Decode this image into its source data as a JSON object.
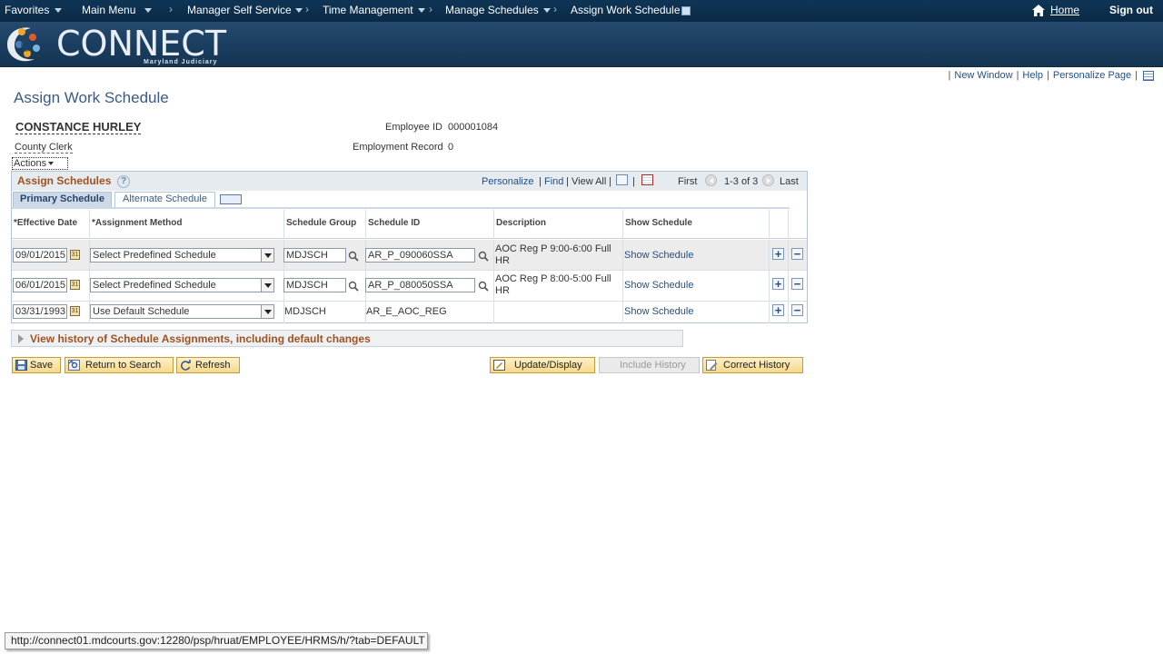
{
  "navbar": {
    "favorites": "Favorites",
    "main_menu": "Main Menu",
    "crumbs": [
      "Manager Self Service",
      "Time Management",
      "Manage Schedules",
      "Assign Work Schedule"
    ],
    "home": "Home",
    "sign_out": "Sign out"
  },
  "banner": {
    "logo_text": "CONNECT",
    "logo_sub": "Maryland Judiciary"
  },
  "pagelinks": {
    "new_window": "New Window",
    "help": "Help",
    "personalize_page": "Personalize Page"
  },
  "page": {
    "title": "Assign Work Schedule",
    "employee_name": "CONSTANCE HURLEY",
    "employee_title": "County Clerk",
    "actions": "Actions",
    "employee_id_label": "Employee ID",
    "employee_id": "000001084",
    "empl_record_label": "Employment Record",
    "empl_record": "0"
  },
  "grid": {
    "title": "Assign Schedules",
    "personalize": "Personalize",
    "find": "Find",
    "view_all": "View All",
    "first": "First",
    "range": "1-3 of 3",
    "last": "Last",
    "tabs": [
      "Primary Schedule",
      "Alternate Schedule"
    ],
    "columns": [
      "*Effective Date",
      "*Assignment Method",
      "Schedule Group",
      "Schedule ID",
      "Description",
      "Show Schedule"
    ],
    "rows": [
      {
        "date": "09/01/2015",
        "method": "Select Predefined Schedule",
        "group": "MDJSCH",
        "schedule_id": "AR_P_090060SSA",
        "description": "AOC Reg P  9:00-6:00 Full HR",
        "show": "Show Schedule"
      },
      {
        "date": "06/01/2015",
        "method": "Select Predefined Schedule",
        "group": "MDJSCH",
        "schedule_id": "AR_P_080050SSA",
        "description": "AOC Reg P  8:00-5:00 Full HR",
        "show": "Show Schedule"
      },
      {
        "date": "03/31/1993",
        "method": "Use Default Schedule",
        "group": "MDJSCH",
        "schedule_id": "AR_E_AOC_REG",
        "description": "",
        "show": "Show Schedule"
      }
    ]
  },
  "history": "View history of Schedule Assignments, including default changes",
  "buttons": {
    "save": "Save",
    "return": "Return to Search",
    "refresh": "Refresh",
    "update": "Update/Display",
    "include_history": "Include History",
    "correct_history": "Correct History"
  },
  "statusbar": "http://connect01.mdcourts.gov:12280/psp/hruat/EMPLOYEE/HRMS/h/?tab=DEFAULT",
  "colors": {
    "nav": "#0f3556",
    "title": "#395a86",
    "accent": "#a0521e",
    "link": "#1f4f8a"
  }
}
